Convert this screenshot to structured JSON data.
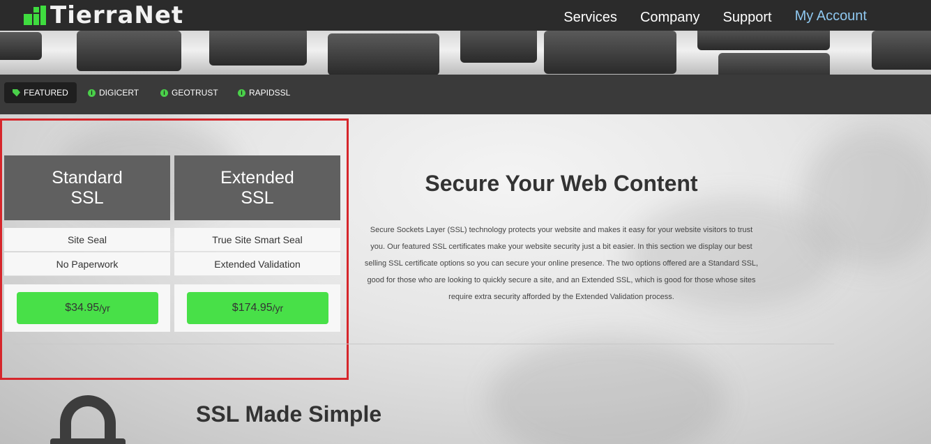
{
  "brand": {
    "name": "TierraNet",
    "accent": "#3fdc3f"
  },
  "main_nav": [
    {
      "label": "Services"
    },
    {
      "label": "Company"
    },
    {
      "label": "Support"
    },
    {
      "label": "My Account"
    }
  ],
  "sub_nav": [
    {
      "label": "FEATURED",
      "icon": "tag-icon",
      "active": true
    },
    {
      "label": "DIGICERT",
      "icon": "info-icon",
      "active": false
    },
    {
      "label": "GEOTRUST",
      "icon": "info-icon",
      "active": false
    },
    {
      "label": "RAPIDSSL",
      "icon": "info-icon",
      "active": false
    }
  ],
  "plans": [
    {
      "title_line1": "Standard",
      "title_line2": "SSL",
      "features": [
        "Site Seal",
        "No Paperwork"
      ],
      "price": "$34.95",
      "unit": "/yr"
    },
    {
      "title_line1": "Extended",
      "title_line2": "SSL",
      "features": [
        "True Site Smart Seal",
        "Extended Validation"
      ],
      "price": "$174.95",
      "unit": "/yr"
    }
  ],
  "intro": {
    "headline": "Secure Your Web Content",
    "body": "Secure Sockets Layer (SSL) technology protects your website and makes it easy for your website visitors to trust you. Our featured SSL certificates make your website security just a bit easier. In this section we display our best selling SSL certificate options so you can secure your online presence. The two options offered are a Standard SSL, good for those who are looking to quickly secure a site, and an Extended SSL, which is good for those whose sites require extra security afforded by the Extended Validation process."
  },
  "section2": {
    "title": "SSL Made Simple",
    "icon": "lock-icon"
  },
  "colors": {
    "price_button": "#48e048",
    "highlight_border": "#d6262b",
    "account_link": "#8fc8f0"
  }
}
